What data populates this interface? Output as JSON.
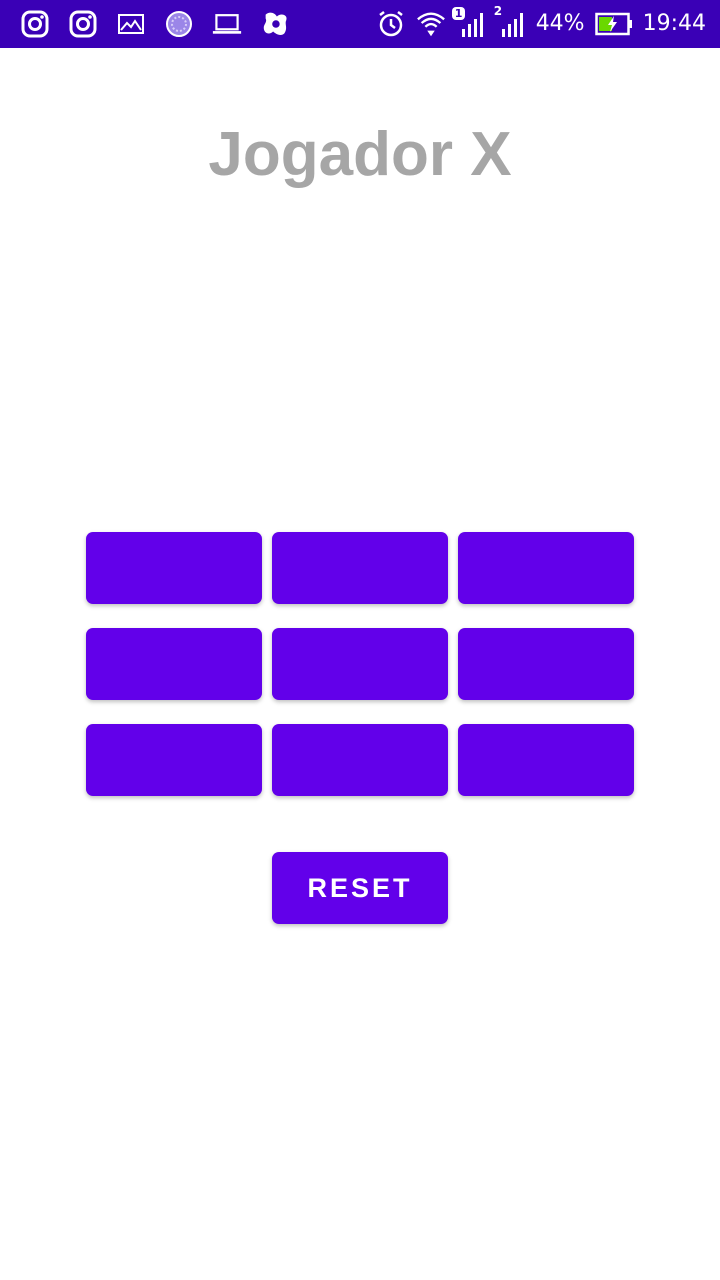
{
  "status_bar": {
    "background_color": "#3a00b6",
    "left_icons": [
      "instagram-icon",
      "instagram-icon",
      "image-icon",
      "circle-spinner-icon",
      "laptop-icon",
      "avast-icon"
    ],
    "right_icons": [
      "alarm-icon",
      "wifi-icon",
      "signal-sim1-icon",
      "signal-sim2-icon",
      "battery-charging-icon"
    ],
    "sim1_badge": "1",
    "sim2_badge": "2",
    "battery_percent": "44%",
    "time": "19:44"
  },
  "game": {
    "title": "Jogador X",
    "title_color": "#a6a6a6",
    "button_color": "#6200ea",
    "cells": [
      "",
      "",
      "",
      "",
      "",
      "",
      "",
      "",
      ""
    ],
    "reset_label": "RESET"
  }
}
